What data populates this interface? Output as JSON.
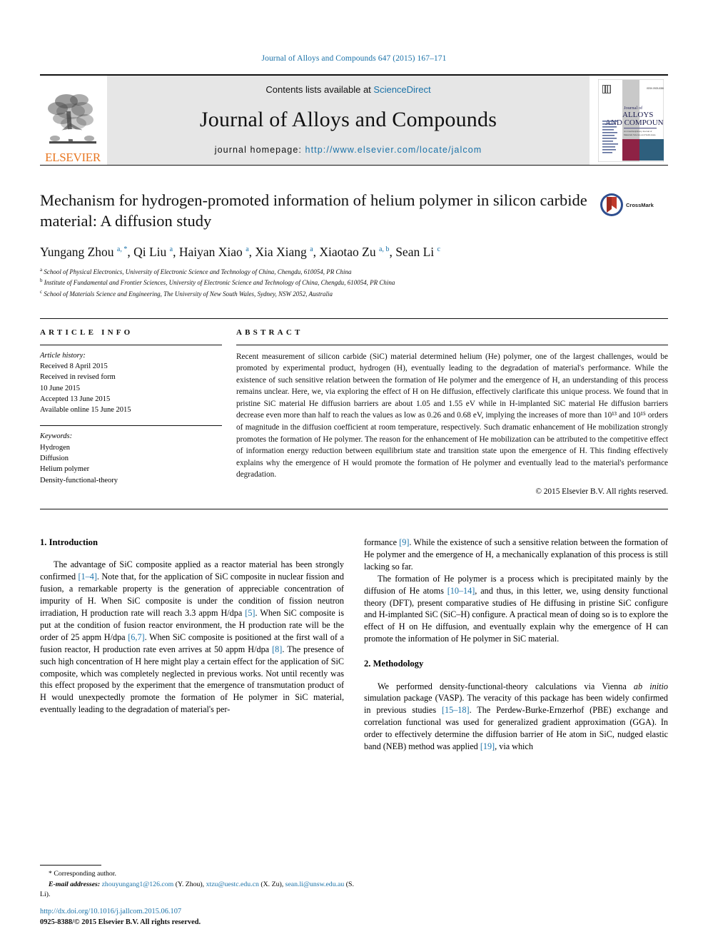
{
  "running_head": "Journal of Alloys and Compounds 647 (2015) 167–171",
  "masthead": {
    "elsevier_word": "ELSEVIER",
    "contents_prefix": "Contents lists available at ",
    "sciencedirect": "ScienceDirect",
    "journal_name": "Journal of Alloys and Compounds",
    "homepage_prefix": "journal homepage: ",
    "homepage_url": "http://www.elsevier.com/locate/jalcom",
    "cover": {
      "line1": "Journal of",
      "line2": "ALLOYS",
      "line3": "AND COMPOUNDS"
    },
    "accent_link_color": "#1b72a8",
    "elsevier_orange": "#E87722"
  },
  "crossmark": {
    "label": "CrossMark"
  },
  "article": {
    "title": "Mechanism for hydrogen-promoted information of helium polymer in silicon carbide material: A diffusion study",
    "authors_html": "Yungang Zhou <sup>a, *</sup>, Qi Liu <sup>a</sup>, Haiyan Xiao <sup>a</sup>, Xia Xiang <sup>a</sup>, Xiaotao Zu <sup>a, b</sup>, Sean Li <sup>c</sup>",
    "affiliations": [
      {
        "marker": "a",
        "text": "School of Physical Electronics, University of Electronic Science and Technology of China, Chengdu, 610054, PR China"
      },
      {
        "marker": "b",
        "text": "Institute of Fundamental and Frontier Sciences, University of Electronic Science and Technology of China, Chengdu, 610054, PR China"
      },
      {
        "marker": "c",
        "text": "School of Materials Science and Engineering, The University of New South Wales, Sydney, NSW 2052, Australia"
      }
    ]
  },
  "article_info": {
    "heading": "ARTICLE INFO",
    "history_label": "Article history:",
    "history": [
      "Received 8 April 2015",
      "Received in revised form",
      "10 June 2015",
      "Accepted 13 June 2015",
      "Available online 15 June 2015"
    ],
    "keywords_label": "Keywords:",
    "keywords": [
      "Hydrogen",
      "Diffusion",
      "Helium polymer",
      "Density-functional-theory"
    ]
  },
  "abstract": {
    "heading": "ABSTRACT",
    "text": "Recent measurement of silicon carbide (SiC) material determined helium (He) polymer, one of the largest challenges, would be promoted by experimental product, hydrogen (H), eventually leading to the degradation of material's performance. While the existence of such sensitive relation between the formation of He polymer and the emergence of H, an understanding of this process remains unclear. Here, we, via exploring the effect of H on He diffusion, effectively clarificate this unique process. We found that in pristine SiC material He diffusion barriers are about 1.05 and 1.55 eV while in H-implanted SiC material He diffusion barriers decrease even more than half to reach the values as low as 0.26 and 0.68 eV, implying the increases of more than 10¹³ and 10¹⁵ orders of magnitude in the diffusion coefficient at room temperature, respectively. Such dramatic enhancement of He mobilization strongly promotes the formation of He polymer. The reason for the enhancement of He mobilization can be attributed to the competitive effect of information energy reduction between equilibrium state and transition state upon the emergence of H. This finding effectively explains why the emergence of H would promote the formation of He polymer and eventually lead to the material's performance degradation.",
    "copyright": "© 2015 Elsevier B.V. All rights reserved."
  },
  "sections": {
    "introduction_heading": "1. Introduction",
    "methodology_heading": "2. Methodology",
    "intro_p1_html": "The advantage of SiC composite applied as a reactor material has been strongly confirmed <span class=\"ref\">[1&ndash;4]</span>. Note that, for the application of SiC composite in nuclear fission and fusion, a remarkable property is the generation of appreciable concentration of impurity of H. When SiC composite is under the condition of fission neutron irradiation, H production rate will reach 3.3 appm H/dpa <span class=\"ref\">[5]</span>. When SiC composite is put at the condition of fusion reactor environment, the H production rate will be the order of 25 appm H/dpa <span class=\"ref\">[6,7]</span>. When SiC composite is positioned at the first wall of a fusion reactor, H production rate even arrives at 50 appm H/dpa <span class=\"ref\">[8]</span>. The presence of such high concentration of H here might play a certain effect for the application of SiC composite, which was completely neglected in previous works. Not until recently was this effect proposed by the experiment that the emergence of transmutation product of H would unexpectedly promote the formation of He polymer in SiC material, eventually leading to the degradation of material's performance <span class=\"ref\">[9]</span>. While the existence of such a sensitive relation between the formation of He polymer and the emergence of H, a mechanically explanation of this process is still lacking so far.",
    "intro_p2_html": "The formation of He polymer is a process which is precipitated mainly by the diffusion of He atoms <span class=\"ref\">[10&ndash;14]</span>, and thus, in this letter, we, using density functional theory (DFT), present comparative studies of He diffusing in pristine SiC configure and H-implanted SiC (SiC&ndash;H) configure. A practical mean of doing so is to explore the effect of H on He diffusion, and eventually explain why the emergence of H can promote the information of He polymer in SiC material.",
    "method_p1_html": "We performed density-functional-theory calculations via Vienna <span class=\"ital\">ab initio</span> simulation package (VASP). The veracity of this package has been widely confirmed in previous studies <span class=\"ref\">[15&ndash;18]</span>. The Perdew-Burke-Ernzerhof (PBE) exchange and correlation functional was used for generalized gradient approximation (GGA). In order to effectively determine the diffusion barrier of He atom in SiC, nudged elastic band (NEB) method was applied <span class=\"ref\">[19]</span>, via which"
  },
  "footnote": {
    "corresponding": "* Corresponding author.",
    "email_label": "E-mail addresses:",
    "emails": [
      {
        "address": "zhouyungang1@126.com",
        "owner": "(Y. Zhou)"
      },
      {
        "address": "xtzu@uestc.edu.cn",
        "owner": "(X. Zu)"
      },
      {
        "address": "sean.li@unsw.edu.au",
        "owner": "(S. Li)."
      }
    ]
  },
  "doi_block": {
    "doi": "http://dx.doi.org/10.1016/j.jallcom.2015.06.107",
    "issn_line": "0925-8388/© 2015 Elsevier B.V. All rights reserved."
  }
}
